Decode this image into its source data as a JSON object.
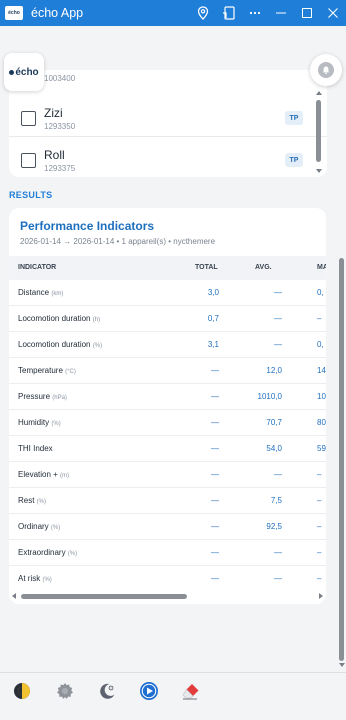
{
  "window": {
    "title": "écho App",
    "logo_text": "écho"
  },
  "brand": {
    "text": "écho"
  },
  "device_list": {
    "cut_off_id": "1003400",
    "items": [
      {
        "name": "Zizi",
        "id": "1293350",
        "tag": "TP",
        "checked": false
      },
      {
        "name": "Roll",
        "id": "1293375",
        "tag": "TP",
        "checked": false
      }
    ]
  },
  "results": {
    "section_label": "RESULTS",
    "card_title": "Performance Indicators",
    "subtitle": "2026-01-14 → 2026-01-14 • 1 appareil(s) • nycthemere",
    "columns": [
      "INDICATOR",
      "TOTAL",
      "AVG.",
      "MA"
    ],
    "rows": [
      {
        "name": "Distance",
        "unit": "(km)",
        "total": "3,0",
        "avg": "—",
        "max": "0,"
      },
      {
        "name": "Locomotion duration",
        "unit": "(h)",
        "total": "0,7",
        "avg": "—",
        "max": "–"
      },
      {
        "name": "Locomotion duration",
        "unit": "(%)",
        "total": "3,1",
        "avg": "—",
        "max": "0,"
      },
      {
        "name": "Temperature",
        "unit": "(°C)",
        "total": "—",
        "avg": "12,0",
        "max": "14,"
      },
      {
        "name": "Pressure",
        "unit": "(hPa)",
        "total": "—",
        "avg": "1010,0",
        "max": "101"
      },
      {
        "name": "Humidity",
        "unit": "(%)",
        "total": "—",
        "avg": "70,7",
        "max": "80,"
      },
      {
        "name": "THI Index",
        "unit": "",
        "total": "—",
        "avg": "54,0",
        "max": "59,"
      },
      {
        "name": "Elevation +",
        "unit": "(m)",
        "total": "—",
        "avg": "—",
        "max": "–"
      },
      {
        "name": "Rest",
        "unit": "(%)",
        "total": "—",
        "avg": "7,5",
        "max": "–"
      },
      {
        "name": "Ordinary",
        "unit": "(%)",
        "total": "—",
        "avg": "92,5",
        "max": "–"
      },
      {
        "name": "Extraordinary",
        "unit": "(%)",
        "total": "—",
        "avg": "—",
        "max": "–"
      },
      {
        "name": "At risk",
        "unit": "(%)",
        "total": "—",
        "avg": "—",
        "max": "–"
      }
    ]
  },
  "toolbar_icons": [
    "day-night-icon",
    "gear-icon",
    "moon-star-icon",
    "play-icon",
    "eraser-icon"
  ],
  "colors": {
    "titlebar": "#1f7ed8",
    "accent": "#1f6fbf",
    "background": "#f3f4f6"
  }
}
